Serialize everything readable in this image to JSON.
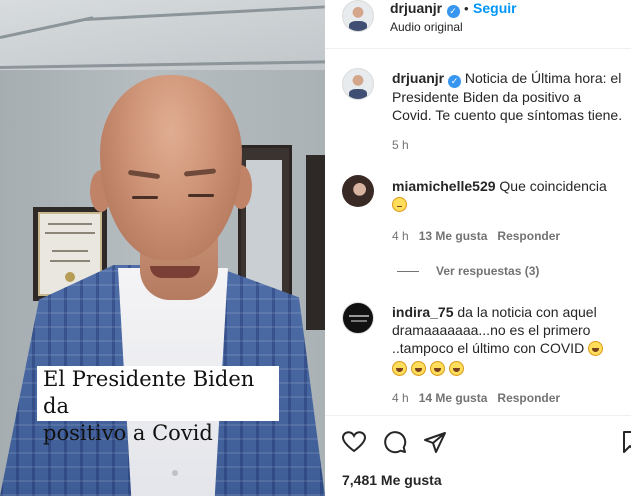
{
  "video": {
    "caption_line1": "El Presidente Biden da",
    "caption_line2": "positivo a Covid"
  },
  "header": {
    "username": "drjuanjr",
    "verified_icon": "verified-badge-icon",
    "separator": "•",
    "follow_label": "Seguir",
    "audio_label": "Audio original"
  },
  "post": {
    "username": "drjuanjr",
    "text": "Noticia de Última hora: el Presidente Biden da positivo a Covid. Te cuento que síntomas tiene.",
    "time": "5 h"
  },
  "comments": [
    {
      "username": "miamichelle529",
      "text": "Que coincidencia",
      "emoji": "face-with-rolling-eyes",
      "time": "4 h",
      "likes": "13 Me gusta",
      "reply_label": "Responder",
      "view_replies": "Ver respuestas (3)"
    },
    {
      "username": "indira_75",
      "text_line1": "da la noticia con aquel",
      "text_line2": "dramaaaaaaa...no es el primero",
      "text_line3": "..tampoco el último con COVID",
      "emoji": "face-with-tears-of-joy",
      "time": "4 h",
      "likes": "14 Me gusta",
      "reply_label": "Responder"
    }
  ],
  "actions": {
    "like_icon": "heart-icon",
    "comment_icon": "comment-icon",
    "share_icon": "paper-plane-icon",
    "save_icon": "bookmark-icon",
    "likes_count": "7,481 Me gusta"
  },
  "colors": {
    "accent": "#0095f6",
    "verified": "#3797f0",
    "text": "#262626",
    "muted": "#737373"
  }
}
